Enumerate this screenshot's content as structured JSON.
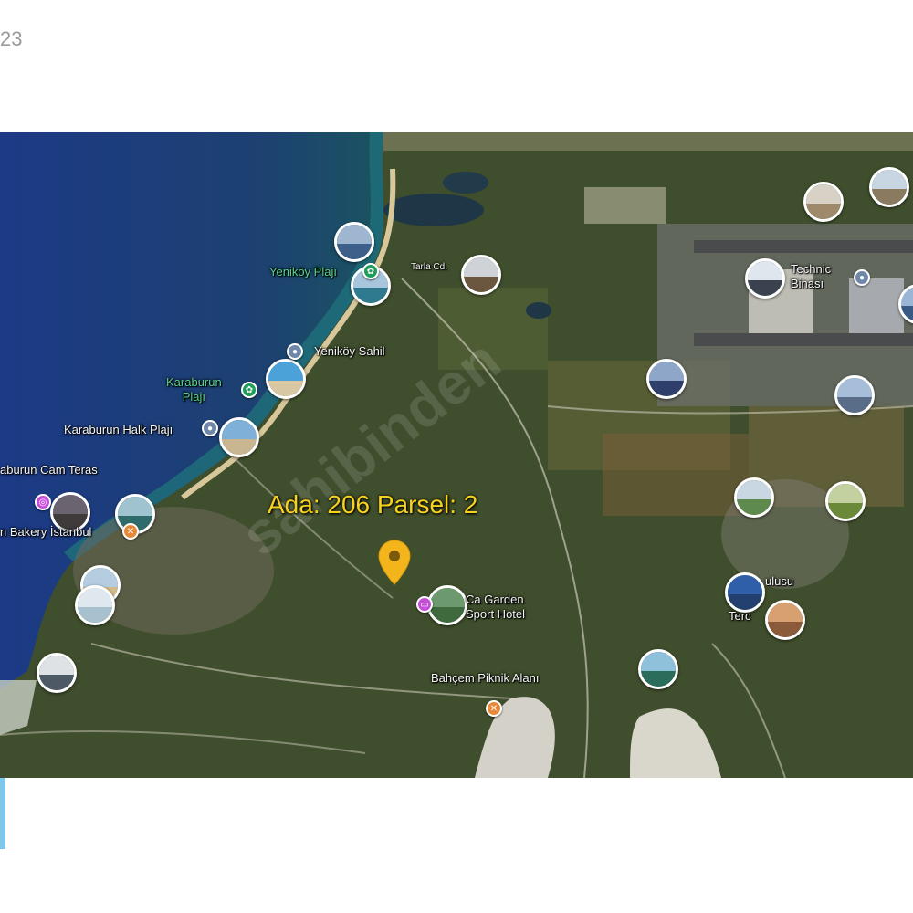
{
  "corner_text": "23",
  "watermark": "sahibinden",
  "parcel": {
    "label": "Ada: 206  Parsel: 2"
  },
  "labels": {
    "yenikoy_plaji": "Yeniköy Plajı",
    "yenikoy_sahil": "Yeniköy Sahil",
    "karaburun_plaji": "Karaburun\nPlajı",
    "karaburun_halk": "Karaburun Halk Plajı",
    "karaburun_cam": "aburun Cam Teras",
    "bakery": "n Bakery İstanbul",
    "garden_hotel": "Ca Garden\nSport Hotel",
    "bahcem": "Bahçem Piknik Alanı",
    "technic": "Technic\nBinası",
    "road_a": "Tarla Cd.",
    "right_1": "ulusu",
    "right_2": "Terc"
  },
  "colors": {
    "sea_deep": "#1f3f8a",
    "sea_shallow": "#1f6f7a",
    "land": "#3f4e2c",
    "parcel_label": "#f7d21d",
    "marker": "#f3b51b",
    "pin_blue": "#6f87a8",
    "pin_green": "#1e9e5b",
    "pin_pink": "#c54bd8",
    "pin_orange": "#e8893a"
  },
  "icons": {
    "marker": "map-pin-icon",
    "photo": "photo-thumbnail-icon",
    "poi": "poi-icon"
  }
}
